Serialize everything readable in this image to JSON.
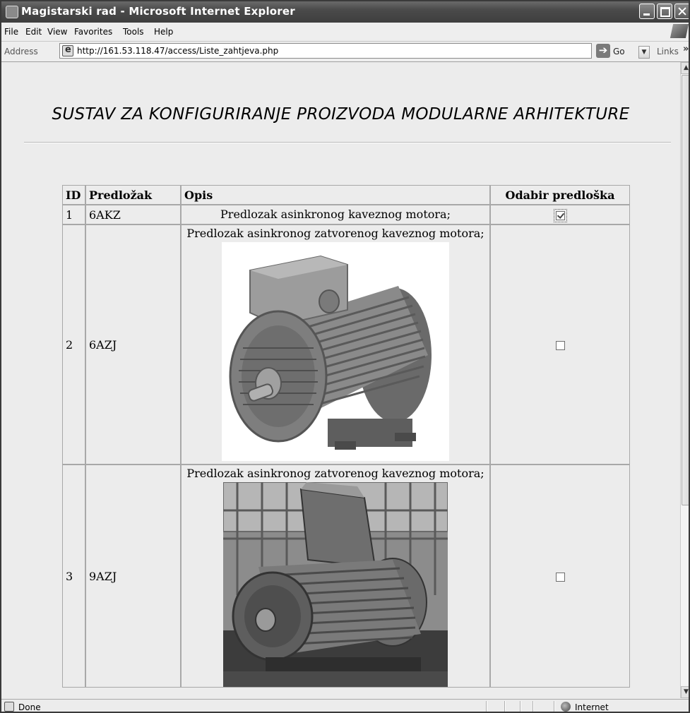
{
  "window": {
    "title": "Magistarski rad - Microsoft Internet Explorer"
  },
  "menu": {
    "items": [
      "File",
      "Edit",
      "View",
      "Favorites",
      "Tools",
      "Help"
    ]
  },
  "address_bar": {
    "label": "Address",
    "url": "http://161.53.118.47/access/Liste_zahtjeva.php",
    "go_label": "Go",
    "links_label": "Links"
  },
  "page": {
    "heading": "SUSTAV ZA KONFIGURIRANJE PROIZVODA MODULARNE ARHITEKTURE"
  },
  "table": {
    "headers": {
      "id": "ID",
      "template": "Predložak",
      "description": "Opis",
      "selection": "Odabir predloška"
    },
    "rows": [
      {
        "id": "1",
        "template": "6AKZ",
        "description": "Predlozak asinkronog kaveznog motora;",
        "checked": true
      },
      {
        "id": "2",
        "template": "6AZJ",
        "description": "Predlozak asinkronog zatvorenog kaveznog motora;",
        "checked": false
      },
      {
        "id": "3",
        "template": "9AZJ",
        "description": "Predlozak asinkronog zatvorenog kaveznog motora;",
        "checked": false
      }
    ]
  },
  "status_bar": {
    "status": "Done",
    "zone": "Internet"
  }
}
